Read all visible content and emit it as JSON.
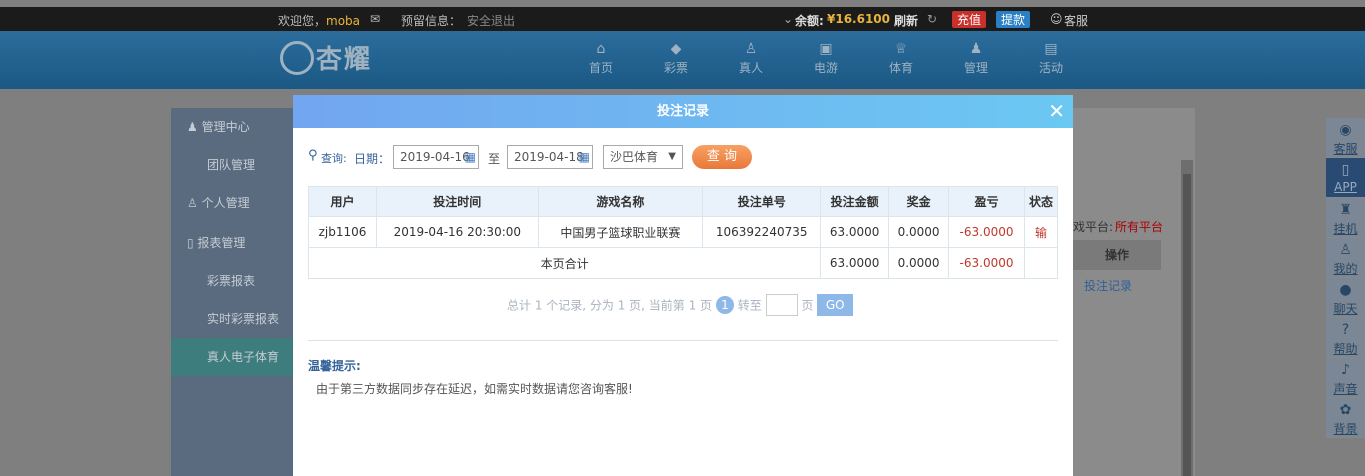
{
  "topbar": {
    "welcome": "欢迎您，",
    "username": "moba",
    "notice_label": "预留信息：",
    "logout": "安全退出",
    "balance_label": "余额:",
    "balance_value": "¥16.6100",
    "refresh": "刷新",
    "recharge": "充值",
    "withdraw": "提款",
    "service": "客服"
  },
  "header": {
    "logo_text": "杏耀",
    "nav": [
      "首页",
      "彩票",
      "真人",
      "电游",
      "体育",
      "管理",
      "活动"
    ]
  },
  "sidebar": {
    "items": [
      {
        "label": "管理中心"
      },
      {
        "label": "团队管理"
      },
      {
        "label": "个人管理"
      },
      {
        "label": "报表管理"
      },
      {
        "label": "彩票报表"
      },
      {
        "label": "实时彩票报表"
      },
      {
        "label": "真人电子体育"
      }
    ]
  },
  "behind": {
    "platform_label": "戏平台:",
    "platform_value": "所有平台",
    "col_action": "操作",
    "action_link": "投注记录"
  },
  "right_rail": [
    "客服",
    "APP",
    "挂机",
    "我的",
    "聊天",
    "帮助",
    "声音",
    "背景"
  ],
  "modal": {
    "title": "投注记录",
    "query_label": "查询:",
    "date_label": "日期：",
    "date_from": "2019-04-16",
    "to_label": "至",
    "date_to": "2019-04-18",
    "platform": "沙巴体育",
    "query_button": "查 询",
    "columns": [
      "用户",
      "投注时间",
      "游戏名称",
      "投注单号",
      "投注金额",
      "奖金",
      "盈亏",
      "状态"
    ],
    "rows": [
      {
        "user": "zjb1106",
        "time": "2019-04-16 20:30:00",
        "game": "中国男子篮球职业联赛",
        "order": "106392240735",
        "amount": "63.0000",
        "bonus": "0.0000",
        "profit": "-63.0000",
        "status": "输"
      }
    ],
    "subtotal": {
      "label": "本页合计",
      "amount": "63.0000",
      "bonus": "0.0000",
      "profit": "-63.0000"
    },
    "pager": {
      "summary": "总计 1 个记录, 分为 1 页, 当前第 1 页",
      "current": "1",
      "goto": "转至",
      "page_unit": "页",
      "go": "GO"
    },
    "tip_title": "温馨提示:",
    "tip_text": "由于第三方数据同步存在延迟，如需实时数据请您咨询客服!"
  }
}
